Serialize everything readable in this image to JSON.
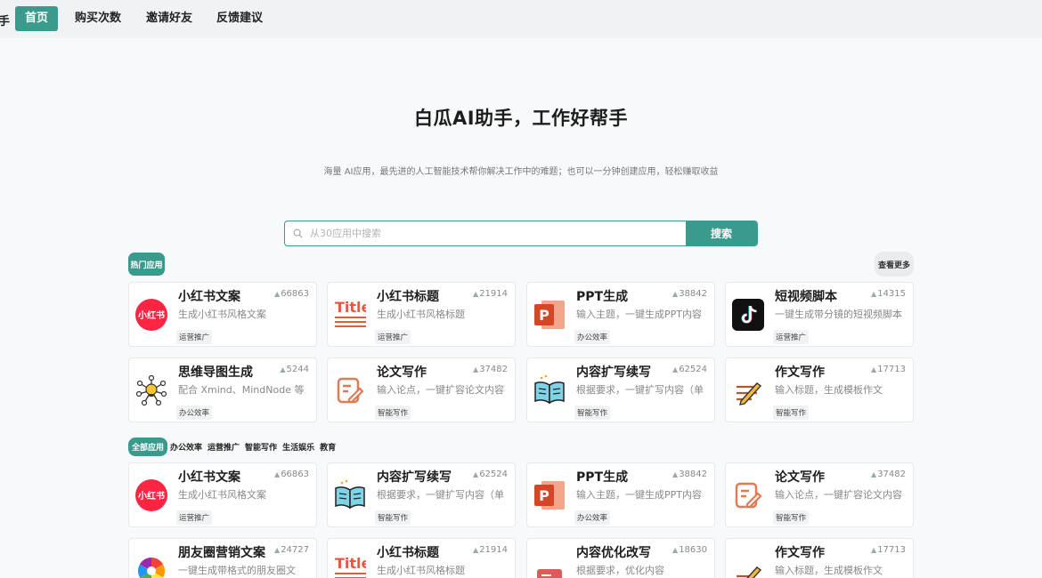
{
  "nav": {
    "brand_tail": "手",
    "items": [
      {
        "label": "首页",
        "active": true
      },
      {
        "label": "购买次数",
        "active": false
      },
      {
        "label": "邀请好友",
        "active": false
      },
      {
        "label": "反馈建议",
        "active": false
      }
    ]
  },
  "hero": {
    "title": "白瓜AI助手，工作好帮手",
    "subtitle": "海量 AI应用，最先进的人工智能技术帮你解决工作中的难题；也可以一分钟创建应用，轻松赚取收益"
  },
  "search": {
    "placeholder": "从30应用中搜索",
    "button": "搜索"
  },
  "hot": {
    "badge": "热门应用",
    "see_more": "查看更多"
  },
  "hot_apps": [
    {
      "title": "小红书文案",
      "count": "66863",
      "desc": "生成小红书风格文案",
      "tag": "运营推广",
      "icon": "xiaohongshu-icon"
    },
    {
      "title": "小红书标题",
      "count": "21914",
      "desc": "生成小红书风格标题",
      "tag": "运营推广",
      "icon": "title-icon"
    },
    {
      "title": "PPT生成",
      "count": "38842",
      "desc": "输入主题，一键生成PPT内容",
      "tag": "办公效率",
      "icon": "ppt-icon"
    },
    {
      "title": "短视频脚本",
      "count": "14315",
      "desc": "一键生成带分镜的短视频脚本",
      "tag": "运营推广",
      "icon": "tiktok-icon"
    },
    {
      "title": "思维导图生成",
      "count": "5244",
      "desc": "配合 Xmind、MindNode 等",
      "tag": "办公效率",
      "icon": "mindmap-icon"
    },
    {
      "title": "论文写作",
      "count": "37482",
      "desc": "输入论点，一键扩容论文内容",
      "tag": "智能写作",
      "icon": "pen-note-icon"
    },
    {
      "title": "内容扩写续写",
      "count": "62524",
      "desc": "根据要求，一键扩写内容（单",
      "tag": "智能写作",
      "icon": "book-icon"
    },
    {
      "title": "作文写作",
      "count": "17713",
      "desc": "输入标题，生成模板作文",
      "tag": "智能写作",
      "icon": "pencil-lines-icon"
    }
  ],
  "filters": [
    "全部应用",
    "办公效率",
    "运营推广",
    "智能写作",
    "生活娱乐",
    "教育"
  ],
  "all_apps": [
    {
      "title": "小红书文案",
      "count": "66863",
      "desc": "生成小红书风格文案",
      "tag": "运营推广",
      "icon": "xiaohongshu-icon"
    },
    {
      "title": "内容扩写续写",
      "count": "62524",
      "desc": "根据要求，一键扩写内容（单",
      "tag": "智能写作",
      "icon": "book-icon"
    },
    {
      "title": "PPT生成",
      "count": "38842",
      "desc": "输入主题，一键生成PPT内容",
      "tag": "办公效率",
      "icon": "ppt-icon"
    },
    {
      "title": "论文写作",
      "count": "37482",
      "desc": "输入论点，一键扩容论文内容",
      "tag": "智能写作",
      "icon": "pen-note-icon"
    },
    {
      "title": "朋友圈营销文案",
      "count": "24727",
      "desc": "一键生成带格式的朋友圈文",
      "tag": "",
      "icon": "aperture-icon"
    },
    {
      "title": "小红书标题",
      "count": "21914",
      "desc": "生成小红书风格标题",
      "tag": "",
      "icon": "title-icon"
    },
    {
      "title": "内容优化改写",
      "count": "18630",
      "desc": "根据要求，优化内容",
      "tag": "",
      "icon": "doc-edit-icon"
    },
    {
      "title": "作文写作",
      "count": "17713",
      "desc": "输入标题，生成模板作文",
      "tag": "",
      "icon": "pencil-lines-icon"
    }
  ],
  "colors": {
    "accent": "#3a9a8c",
    "xiaohongshu": "#ff2442",
    "ppt": "#d24726"
  }
}
